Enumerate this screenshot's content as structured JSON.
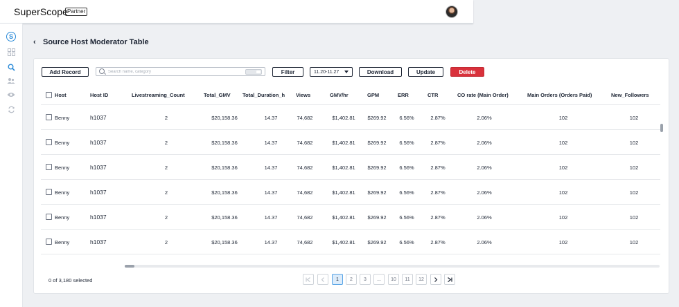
{
  "app": {
    "brand": "SuperScope",
    "badge": "Partner"
  },
  "page": {
    "title": "Source Host Moderator Table"
  },
  "toolbar": {
    "add_label": "Add Record",
    "search_placeholder": "Search name, category",
    "filter_label": "Filter",
    "date_range": "11.20-11.27",
    "download_label": "Download",
    "update_label": "Update",
    "delete_label": "Delete"
  },
  "table": {
    "columns": [
      "Host",
      "Host ID",
      "Livestreaming_Count",
      "Total_GMV",
      "Total_Duration_h",
      "Views",
      "GMV/hr",
      "GPM",
      "ERR",
      "CTR",
      "CO rate (Main Order)",
      "Main Orders (Orders Paid)",
      "New_Followers"
    ],
    "rows": [
      [
        "Benny",
        "h1037",
        "2",
        "$20,158.36",
        "14.37",
        "74,682",
        "$1,402.81",
        "$269.92",
        "6.56%",
        "2.87%",
        "2.06%",
        "102",
        "102"
      ],
      [
        "Benny",
        "h1037",
        "2",
        "$20,158.36",
        "14.37",
        "74,682",
        "$1,402.81",
        "$269.92",
        "6.56%",
        "2.87%",
        "2.06%",
        "102",
        "102"
      ],
      [
        "Benny",
        "h1037",
        "2",
        "$20,158.36",
        "14.37",
        "74,682",
        "$1,402.81",
        "$269.92",
        "6.56%",
        "2.87%",
        "2.06%",
        "102",
        "102"
      ],
      [
        "Benny",
        "h1037",
        "2",
        "$20,158.36",
        "14.37",
        "74,682",
        "$1,402.81",
        "$269.92",
        "6.56%",
        "2.87%",
        "2.06%",
        "102",
        "102"
      ],
      [
        "Benny",
        "h1037",
        "2",
        "$20,158.36",
        "14.37",
        "74,682",
        "$1,402.81",
        "$269.92",
        "6.56%",
        "2.87%",
        "2.06%",
        "102",
        "102"
      ],
      [
        "Benny",
        "h1037",
        "2",
        "$20,158.36",
        "14.37",
        "74,682",
        "$1,402.81",
        "$269.92",
        "6.56%",
        "2.87%",
        "2.06%",
        "102",
        "102"
      ]
    ]
  },
  "footer": {
    "selection": "0 of 3,180 selected",
    "pages": [
      "1",
      "2",
      "3",
      "...",
      "10",
      "11",
      "12"
    ],
    "current_page": "1"
  },
  "icons": {
    "sidebar": [
      "superscope-logo-icon",
      "grid-icon",
      "search-icon",
      "users-icon",
      "eye-icon",
      "refresh-icon"
    ],
    "pager": [
      "first-page-icon",
      "prev-page-icon",
      "next-page-icon",
      "last-page-icon"
    ]
  },
  "colors": {
    "accent": "#2a8ad8",
    "danger": "#d9313b",
    "active_page": "#dcecfb"
  }
}
